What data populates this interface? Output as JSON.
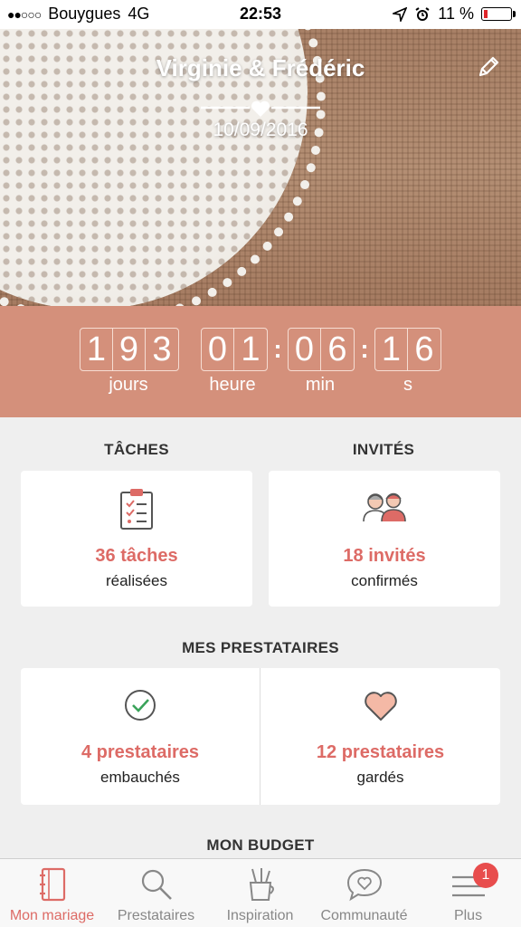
{
  "status_bar": {
    "signal": "●●○○○",
    "carrier": "Bouygues",
    "network": "4G",
    "time": "22:53",
    "battery": "11 %"
  },
  "hero": {
    "couple": "Virginie & Frédéric",
    "date": "10/09/2016",
    "icons": [
      "pencil-icon",
      "heart-divider-icon"
    ]
  },
  "countdown": {
    "days": [
      "1",
      "9",
      "3"
    ],
    "hours": [
      "0",
      "1"
    ],
    "minutes": [
      "0",
      "6"
    ],
    "seconds": [
      "1",
      "6"
    ],
    "separator": ":",
    "labels": {
      "days": "jours",
      "hours": "heure",
      "minutes": "min",
      "seconds": "s"
    }
  },
  "tasks": {
    "title": "TÂCHES",
    "count": "36 tâches",
    "sub": "réalisées",
    "icon": "clipboard-icon"
  },
  "guests": {
    "title": "INVITÉS",
    "count": "18 invités",
    "sub": "confirmés",
    "icon": "guests-icon"
  },
  "vendors": {
    "title": "MES PRESTATAIRES",
    "hired": {
      "count": "4 prestataires",
      "sub": "embauchés",
      "icon": "check-circle-icon"
    },
    "saved": {
      "count": "12 prestataires",
      "sub": "gardés",
      "icon": "heart-icon"
    }
  },
  "budget": {
    "title": "MON BUDGET"
  },
  "tabbar": {
    "accent": "#dd6b66",
    "items": [
      {
        "label": "Mon mariage",
        "icon": "notebook-icon",
        "active": true
      },
      {
        "label": "Prestataires",
        "icon": "search-icon",
        "active": false
      },
      {
        "label": "Inspiration",
        "icon": "brushes-icon",
        "active": false
      },
      {
        "label": "Communauté",
        "icon": "chat-heart-icon",
        "active": false
      },
      {
        "label": "Plus",
        "icon": "menu-icon",
        "active": false,
        "badge": "1"
      }
    ]
  },
  "colors": {
    "accent": "#dd6b66",
    "countdown_bg": "#d4907b",
    "background": "#efefef"
  }
}
